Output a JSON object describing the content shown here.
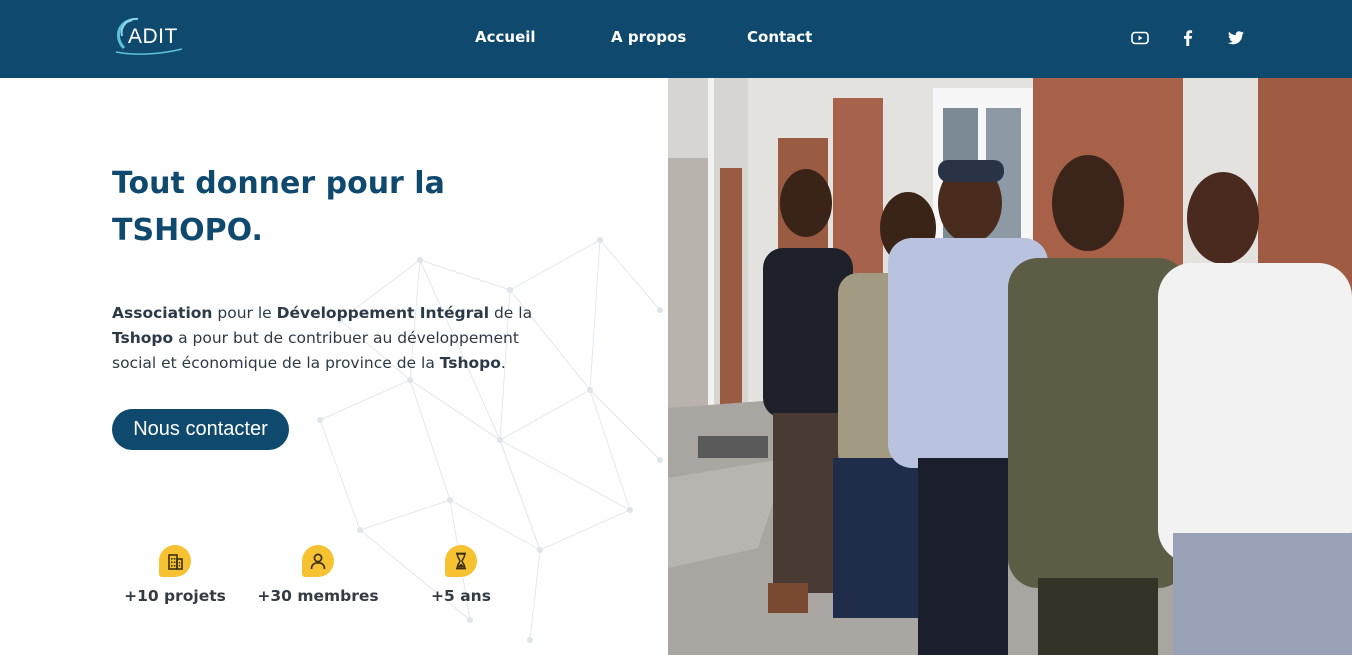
{
  "header": {
    "logo_text": "ADIT",
    "nav": [
      {
        "label": "Accueil"
      },
      {
        "label": "A propos"
      },
      {
        "label": "Contact"
      }
    ],
    "social_icons": [
      "youtube-icon",
      "facebook-icon",
      "twitter-icon"
    ]
  },
  "hero": {
    "title_line1": "Tout donner pour la",
    "title_line2": "TSHOPO.",
    "description": {
      "p1": "Association",
      "p2": " pour le ",
      "p3": "Développement Intégral",
      "p4": " de la ",
      "p5": "Tshopo",
      "p6": " a pour but de contribuer au développement social et économique de la province de la ",
      "p7": "Tshopo",
      "p8": "."
    },
    "cta_label": "Nous contacter"
  },
  "stats": [
    {
      "label": "+10 projets",
      "icon": "building-icon"
    },
    {
      "label": "+30 membres",
      "icon": "user-icon"
    },
    {
      "label": "+5 ans",
      "icon": "hourglass-icon"
    }
  ],
  "colors": {
    "primary": "#0f4a6e",
    "accent": "#f6c232",
    "text": "#2c3a47"
  }
}
